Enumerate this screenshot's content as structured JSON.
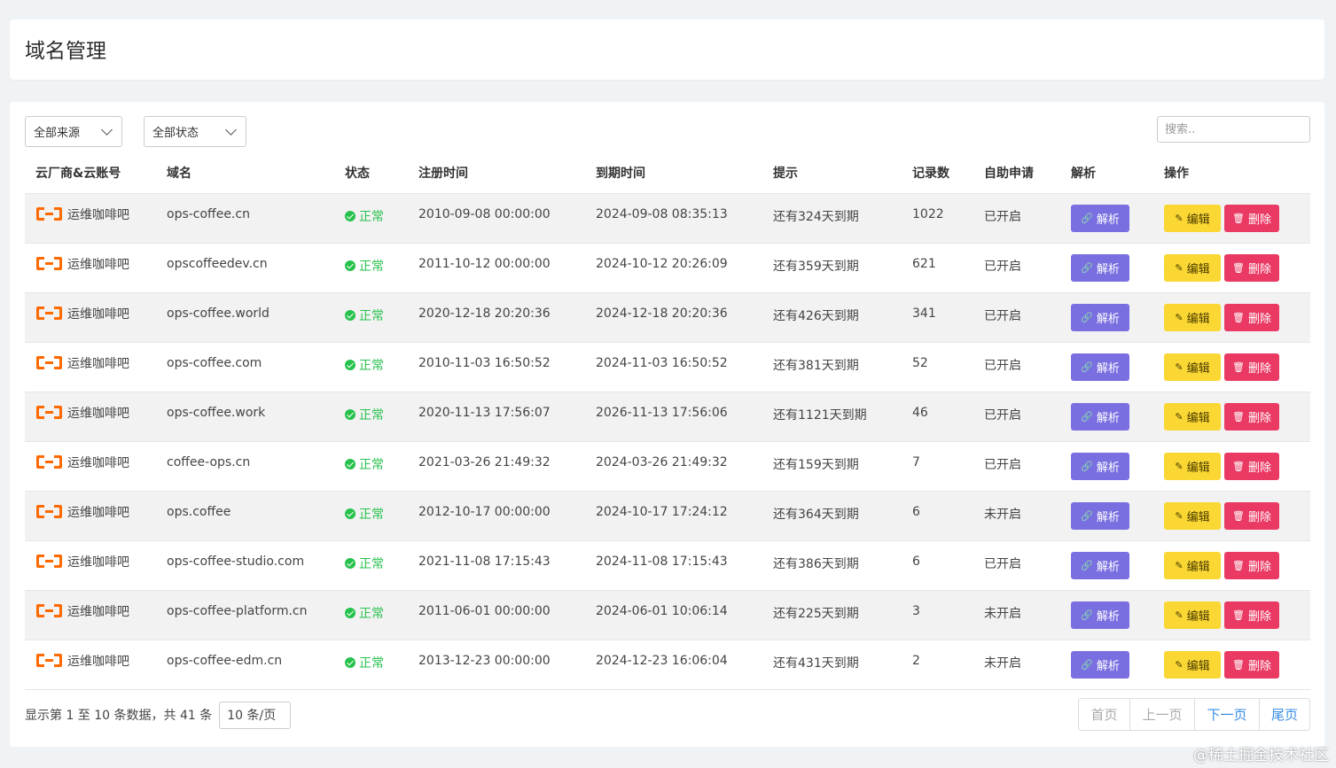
{
  "page": {
    "title": "域名管理"
  },
  "filters": {
    "source_label": "全部来源",
    "status_label": "全部状态",
    "search_placeholder": "搜索.."
  },
  "table": {
    "headers": [
      "云厂商&云账号",
      "域名",
      "状态",
      "注册时间",
      "到期时间",
      "提示",
      "记录数",
      "自助申请",
      "解析",
      "操作"
    ],
    "rows": [
      {
        "vendor": "运维咖啡吧",
        "domain": "ops-coffee.cn",
        "status": "正常",
        "reg": "2010-09-08 00:00:00",
        "exp": "2024-09-08 08:35:13",
        "tip": "还有324天到期",
        "records": "1022",
        "self": "已开启"
      },
      {
        "vendor": "运维咖啡吧",
        "domain": "opscoffeedev.cn",
        "status": "正常",
        "reg": "2011-10-12 00:00:00",
        "exp": "2024-10-12 20:26:09",
        "tip": "还有359天到期",
        "records": "621",
        "self": "已开启"
      },
      {
        "vendor": "运维咖啡吧",
        "domain": "ops-coffee.world",
        "status": "正常",
        "reg": "2020-12-18 20:20:36",
        "exp": "2024-12-18 20:20:36",
        "tip": "还有426天到期",
        "records": "341",
        "self": "已开启"
      },
      {
        "vendor": "运维咖啡吧",
        "domain": "ops-coffee.com",
        "status": "正常",
        "reg": "2010-11-03 16:50:52",
        "exp": "2024-11-03 16:50:52",
        "tip": "还有381天到期",
        "records": "52",
        "self": "已开启"
      },
      {
        "vendor": "运维咖啡吧",
        "domain": "ops-coffee.work",
        "status": "正常",
        "reg": "2020-11-13 17:56:07",
        "exp": "2026-11-13 17:56:06",
        "tip": "还有1121天到期",
        "records": "46",
        "self": "已开启"
      },
      {
        "vendor": "运维咖啡吧",
        "domain": "coffee-ops.cn",
        "status": "正常",
        "reg": "2021-03-26 21:49:32",
        "exp": "2024-03-26 21:49:32",
        "tip": "还有159天到期",
        "records": "7",
        "self": "已开启"
      },
      {
        "vendor": "运维咖啡吧",
        "domain": "ops.coffee",
        "status": "正常",
        "reg": "2012-10-17 00:00:00",
        "exp": "2024-10-17 17:24:12",
        "tip": "还有364天到期",
        "records": "6",
        "self": "未开启"
      },
      {
        "vendor": "运维咖啡吧",
        "domain": "ops-coffee-studio.com",
        "status": "正常",
        "reg": "2021-11-08 17:15:43",
        "exp": "2024-11-08 17:15:43",
        "tip": "还有386天到期",
        "records": "6",
        "self": "已开启"
      },
      {
        "vendor": "运维咖啡吧",
        "domain": "ops-coffee-platform.cn",
        "status": "正常",
        "reg": "2011-06-01 00:00:00",
        "exp": "2024-06-01 10:06:14",
        "tip": "还有225天到期",
        "records": "3",
        "self": "未开启"
      },
      {
        "vendor": "运维咖啡吧",
        "domain": "ops-coffee-edm.cn",
        "status": "正常",
        "reg": "2013-12-23 00:00:00",
        "exp": "2024-12-23 16:06:04",
        "tip": "还有431天到期",
        "records": "2",
        "self": "未开启"
      }
    ],
    "buttons": {
      "parse": "解析",
      "edit": "编辑",
      "delete": "删除"
    }
  },
  "footer": {
    "info": "显示第 1 至 10 条数据，共 41 条",
    "page_size": "10 条/页",
    "pager": {
      "first": "首页",
      "prev": "上一页",
      "next": "下一页",
      "last": "尾页"
    }
  },
  "colors": {
    "status_ok": "#27c24c",
    "parse_button": "#7a6fe0",
    "edit_button": "#fad733",
    "delete_button": "#ea3a63",
    "vendor_logo": "#ff6a00",
    "pager_active": "#3a8ee6"
  },
  "icons": {
    "vendor": "aliyun-logo-icon",
    "status": "check-circle-icon",
    "parse": "link-icon",
    "edit": "edit-icon",
    "delete": "trash-icon"
  },
  "watermark": "@稀土掘金技术社区"
}
